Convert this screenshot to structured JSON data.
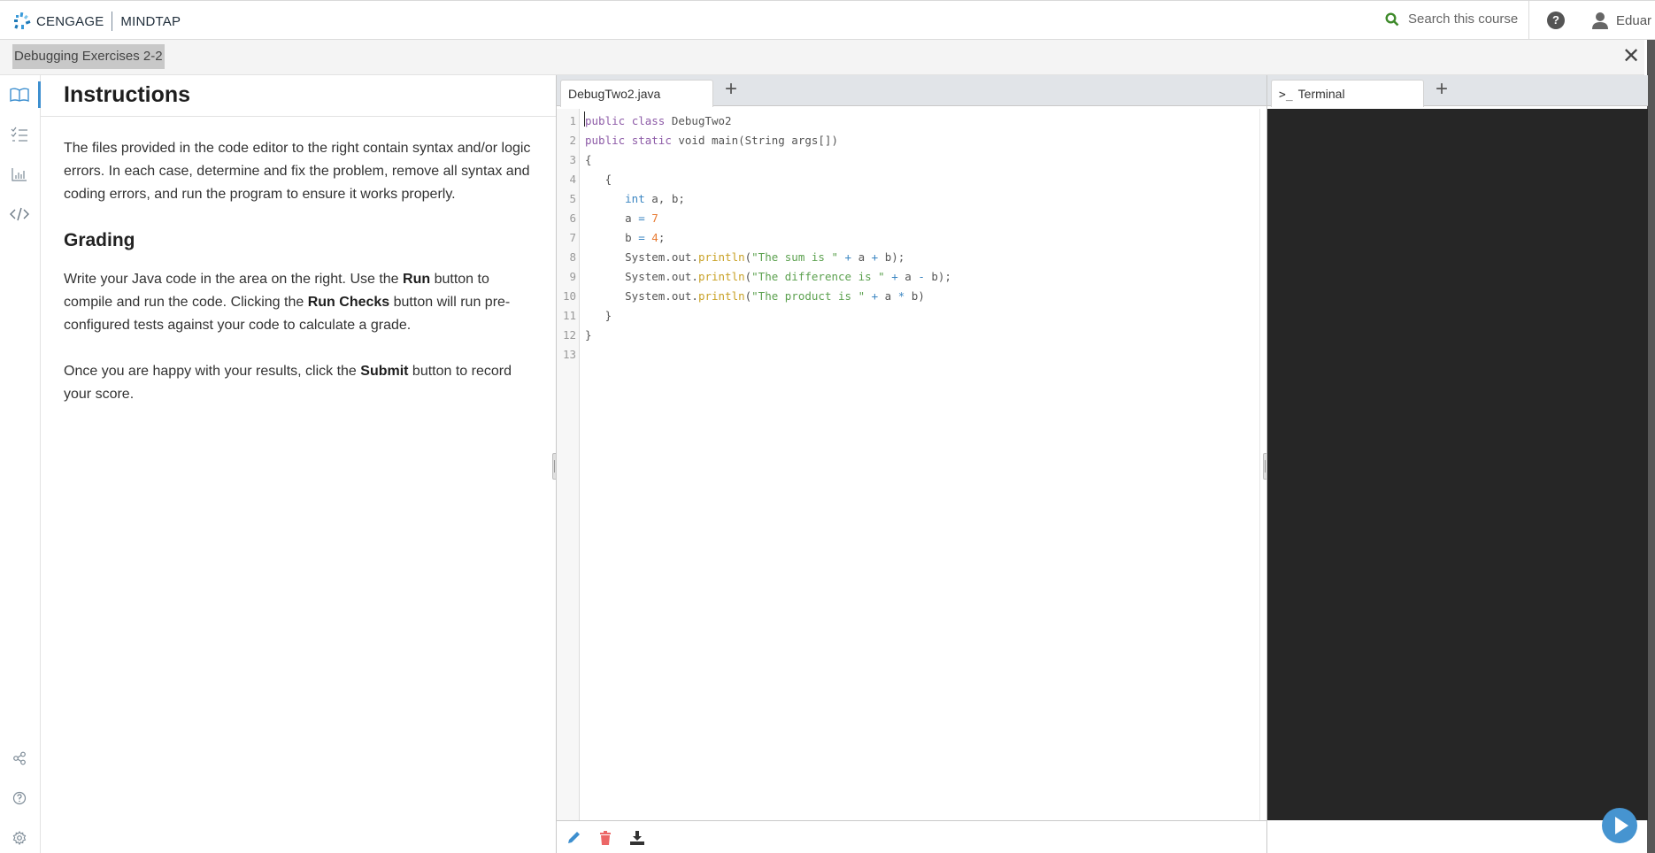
{
  "header": {
    "brand": "CENGAGE",
    "product": "MINDTAP",
    "search_placeholder": "Search this course",
    "user_name": "Eduar",
    "colors": {
      "search_icon": "#3e8a2a",
      "accent": "#3d8fcf"
    }
  },
  "subheader": {
    "breadcrumb": "Debugging Exercises 2-2",
    "close_label": "✕"
  },
  "rail": {
    "items": [
      {
        "name": "instructions",
        "icon": "book-icon",
        "active": true
      },
      {
        "name": "checklist",
        "icon": "checklist-icon",
        "active": false
      },
      {
        "name": "grades",
        "icon": "bar-chart-icon",
        "active": false
      },
      {
        "name": "code",
        "icon": "code-icon",
        "active": false
      }
    ],
    "bottom_items": [
      {
        "name": "share",
        "icon": "share-icon"
      },
      {
        "name": "help",
        "icon": "help-circle-icon"
      },
      {
        "name": "settings",
        "icon": "gear-icon"
      }
    ]
  },
  "instructions": {
    "title": "Instructions",
    "intro": "The files provided in the code editor to the right contain syntax and/or logic errors. In each case, determine and fix the problem, remove all syntax and coding errors, and run the program to ensure it works properly.",
    "grading_heading": "Grading",
    "grading_p1_a": "Write your Java code in the area on the right. Use the ",
    "grading_p1_run": "Run",
    "grading_p1_b": " button to compile and run the code. Clicking the ",
    "grading_p1_checks": "Run Checks",
    "grading_p1_c": " button will run pre-configured tests against your code to calculate a grade.",
    "grading_p2_a": "Once you are happy with your results, click the ",
    "grading_p2_submit": "Submit",
    "grading_p2_b": " button to record your score."
  },
  "editor": {
    "tab_label": "DebugTwo2.java",
    "add_tab_label": "+",
    "line_numbers": [
      "1",
      "2",
      "3",
      "4",
      "5",
      "6",
      "7",
      "8",
      "9",
      "10",
      "11",
      "12",
      "13"
    ],
    "code": [
      "public class DebugTwo2",
      "public static void main(String args[])",
      "{",
      "   {",
      "      int a, b;",
      "      a = 7",
      "      b = 4;",
      "      System.out.println(\"The sum is \" + a + b);",
      "      System.out.println(\"The difference is \" + a - b);",
      "      System.out.println(\"The product is \" + a * b)",
      "   }",
      "}",
      ""
    ],
    "footer_actions": [
      "edit-icon",
      "delete-icon",
      "download-icon"
    ]
  },
  "terminal": {
    "tab_label": "Terminal",
    "add_tab_label": "+",
    "run_button": "run"
  }
}
